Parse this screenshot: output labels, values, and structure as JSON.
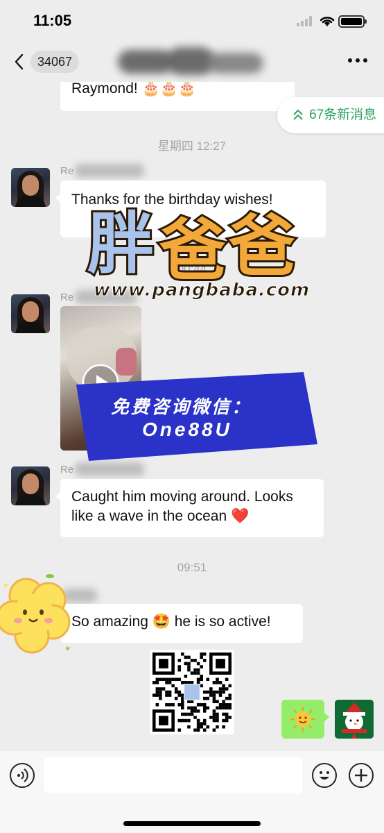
{
  "status_bar": {
    "time": "11:05"
  },
  "nav": {
    "unread_count": "34067",
    "title": ""
  },
  "new_messages_pill": "67条新消息",
  "messages": [
    {
      "type": "text",
      "text": "Raymond! 🎂🎂🎂"
    },
    {
      "type": "timestamp",
      "text": "星期四 12:27"
    },
    {
      "type": "text",
      "sender": "Re",
      "text": "Thanks for the birthday wishes!"
    },
    {
      "type": "timestamp",
      "text": "00:44"
    },
    {
      "type": "video",
      "sender": "Re"
    },
    {
      "type": "text",
      "sender": "Re",
      "text": "Caught him moving around. Looks like a wave in the ocean ❤️"
    },
    {
      "type": "timestamp",
      "text": "09:51"
    },
    {
      "type": "text",
      "sender": "",
      "text": "So amazing 🤩 he is so active!"
    }
  ],
  "watermark": {
    "brand": "胖爸爸",
    "url": "www.pangbaba.com",
    "promo_line1": "免费咨询微信：",
    "promo_line2": "One88U"
  },
  "colors": {
    "background": "#ededed",
    "bubble_in": "#ffffff",
    "bubble_out": "#95ec69",
    "accent_green": "#2ba160",
    "promo_blue": "#2a32c8"
  },
  "icons": {
    "back": "chevron-left-icon",
    "more": "more-icon",
    "voice": "voice-icon",
    "emoji": "emoji-icon",
    "plus": "plus-icon",
    "play": "play-icon"
  }
}
